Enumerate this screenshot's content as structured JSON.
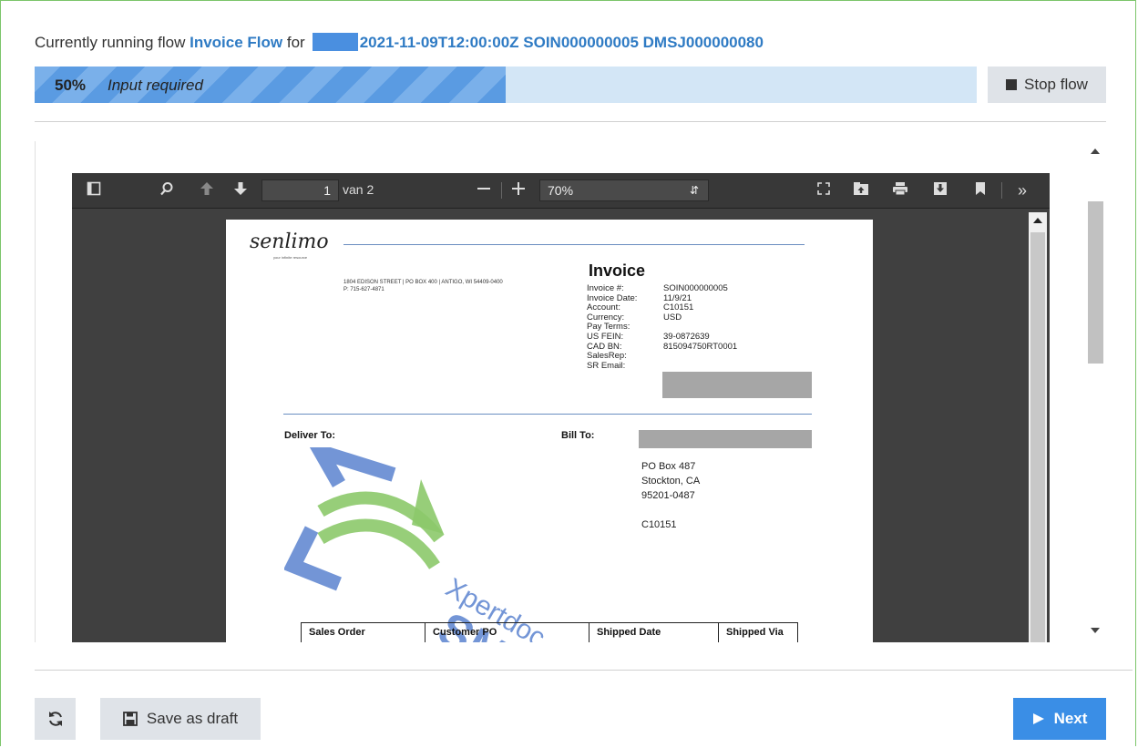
{
  "header": {
    "prefix": "Currently running flow",
    "flow_name": "Invoice Flow",
    "for_label": "for",
    "record_id": "2021-11-09T12:00:00Z SOIN000000005 DMSJ000000080"
  },
  "progress": {
    "fraction": 0.5,
    "percent_label": "50%",
    "status_text": "Input required"
  },
  "stop_button": {
    "label": "Stop flow"
  },
  "viewer": {
    "page_number": "1",
    "page_of": "van 2",
    "zoom": "70%"
  },
  "invoice": {
    "logo": "senlimo",
    "tagline": "your infinite resource",
    "address_line1": "1804 EDISON STREET   |   PO BOX 400   |   ANTIGO, WI 54409-0400",
    "address_line2": "P: 715-627-4871",
    "title": "Invoice",
    "fields": [
      {
        "key": "Invoice #:",
        "value": "SOIN000000005"
      },
      {
        "key": "Invoice Date:",
        "value": "11/9/21"
      },
      {
        "key": "Account:",
        "value": "C10151"
      },
      {
        "key": "Currency:",
        "value": "USD"
      },
      {
        "key": "Pay Terms:",
        "value": ""
      },
      {
        "key": "US FEIN:",
        "value": "39-0872639"
      },
      {
        "key": "CAD BN:",
        "value": "815094750RT0001"
      },
      {
        "key": "SalesRep:",
        "value": ""
      },
      {
        "key": "SR Email:",
        "value": ""
      }
    ],
    "deliver_to_label": "Deliver To:",
    "bill_to_label": "Bill To:",
    "bill_address": [
      "PO Box 487",
      "Stockton, CA",
      "95201-0487",
      "",
      "C10151"
    ],
    "table_headers": [
      "Sales Order",
      "Customer PO",
      "Shipped Date",
      "Shipped Via"
    ],
    "watermark_text": "Xpertdoc",
    "watermark_text2": "SMA"
  },
  "footer": {
    "save_draft_label": "Save as draft",
    "next_label": "Next"
  },
  "colors": {
    "accent": "#3a8ee6",
    "link": "#2f7bc4",
    "frame_border": "#7cc56b"
  }
}
